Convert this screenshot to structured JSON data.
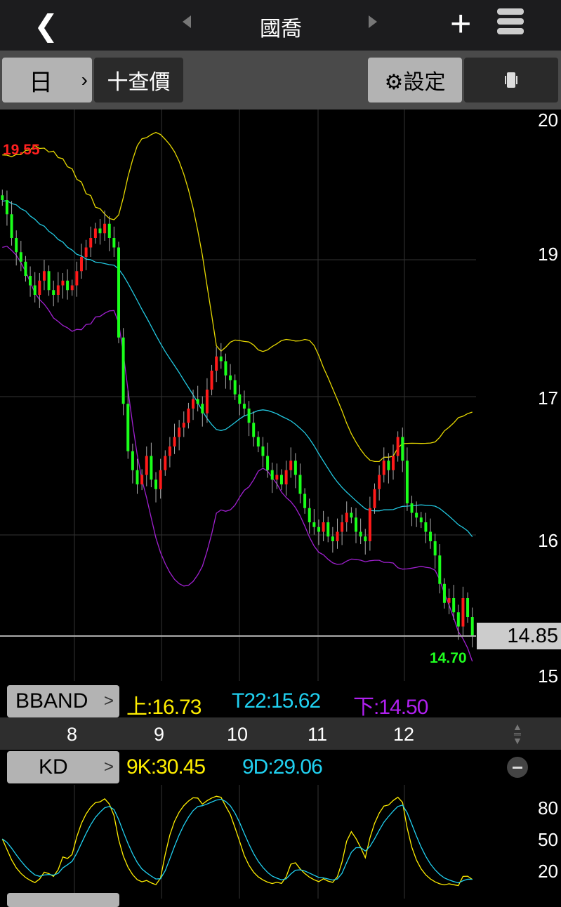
{
  "header": {
    "title": "國喬",
    "back_icon": "chevron-left-icon",
    "prev_icon": "triangle-left-icon",
    "next_icon": "triangle-right-icon",
    "add_icon": "plus-icon",
    "menu_icon": "hamburger-icon"
  },
  "toolbar": {
    "period": "日",
    "period_chevron": "›",
    "quote": "十查價",
    "settings": "⚙設定",
    "rotate_icon": "rotate-icon"
  },
  "price_axis": {
    "labels": [
      "20",
      "19",
      "17",
      "16",
      "15"
    ],
    "current": "14.85"
  },
  "annotations": {
    "high": "19.55",
    "low": "14.70"
  },
  "bband": {
    "tag": "BBAND",
    "upper": "上:16.73",
    "mid": "T22:15.62",
    "lower": "下:14.50",
    "arrow": "↾"
  },
  "date_axis": [
    "8",
    "9",
    "10",
    "11",
    "12"
  ],
  "kd": {
    "tag": "KD",
    "k": "9K:30.45",
    "d": "9D:29.06",
    "axis": [
      "80",
      "50",
      "20"
    ]
  },
  "colors": {
    "up": "#ff1a1a",
    "down": "#1aff1a",
    "upper": "#e6d800",
    "mid": "#22c8e0",
    "lower": "#a020d0",
    "k": "#ffee00",
    "d": "#20d0f0"
  },
  "chart_data": {
    "type": "candlestick",
    "indicator": "BBAND(22) / KD(9)",
    "close": [
      19.45,
      19.3,
      19.05,
      18.9,
      18.8,
      18.65,
      18.55,
      18.45,
      18.6,
      18.7,
      18.5,
      18.45,
      18.55,
      18.6,
      18.5,
      18.55,
      18.7,
      18.85,
      18.95,
      19.05,
      19.15,
      19.1,
      19.2,
      19.05,
      18.95,
      18.0,
      17.3,
      16.8,
      16.6,
      16.45,
      16.55,
      16.75,
      16.5,
      16.4,
      16.6,
      16.75,
      16.85,
      16.95,
      17.05,
      17.1,
      17.25,
      17.35,
      17.3,
      17.2,
      17.45,
      17.65,
      17.8,
      17.75,
      17.6,
      17.55,
      17.4,
      17.3,
      17.25,
      17.1,
      16.95,
      16.85,
      16.75,
      16.6,
      16.5,
      16.55,
      16.45,
      16.6,
      16.7,
      16.55,
      16.35,
      16.2,
      16.05,
      16.0,
      15.95,
      16.05,
      15.9,
      15.85,
      15.95,
      16.05,
      16.15,
      16.1,
      15.95,
      15.9,
      15.85,
      16.2,
      16.4,
      16.55,
      16.7,
      16.6,
      16.75,
      16.95,
      16.7,
      16.25,
      16.15,
      16.1,
      16.05,
      15.95,
      15.85,
      15.7,
      15.4,
      15.2,
      15.25,
      15.1,
      14.95,
      15.25,
      15.05,
      14.85
    ],
    "last": 14.85,
    "high": 19.55,
    "low": 14.7
  }
}
